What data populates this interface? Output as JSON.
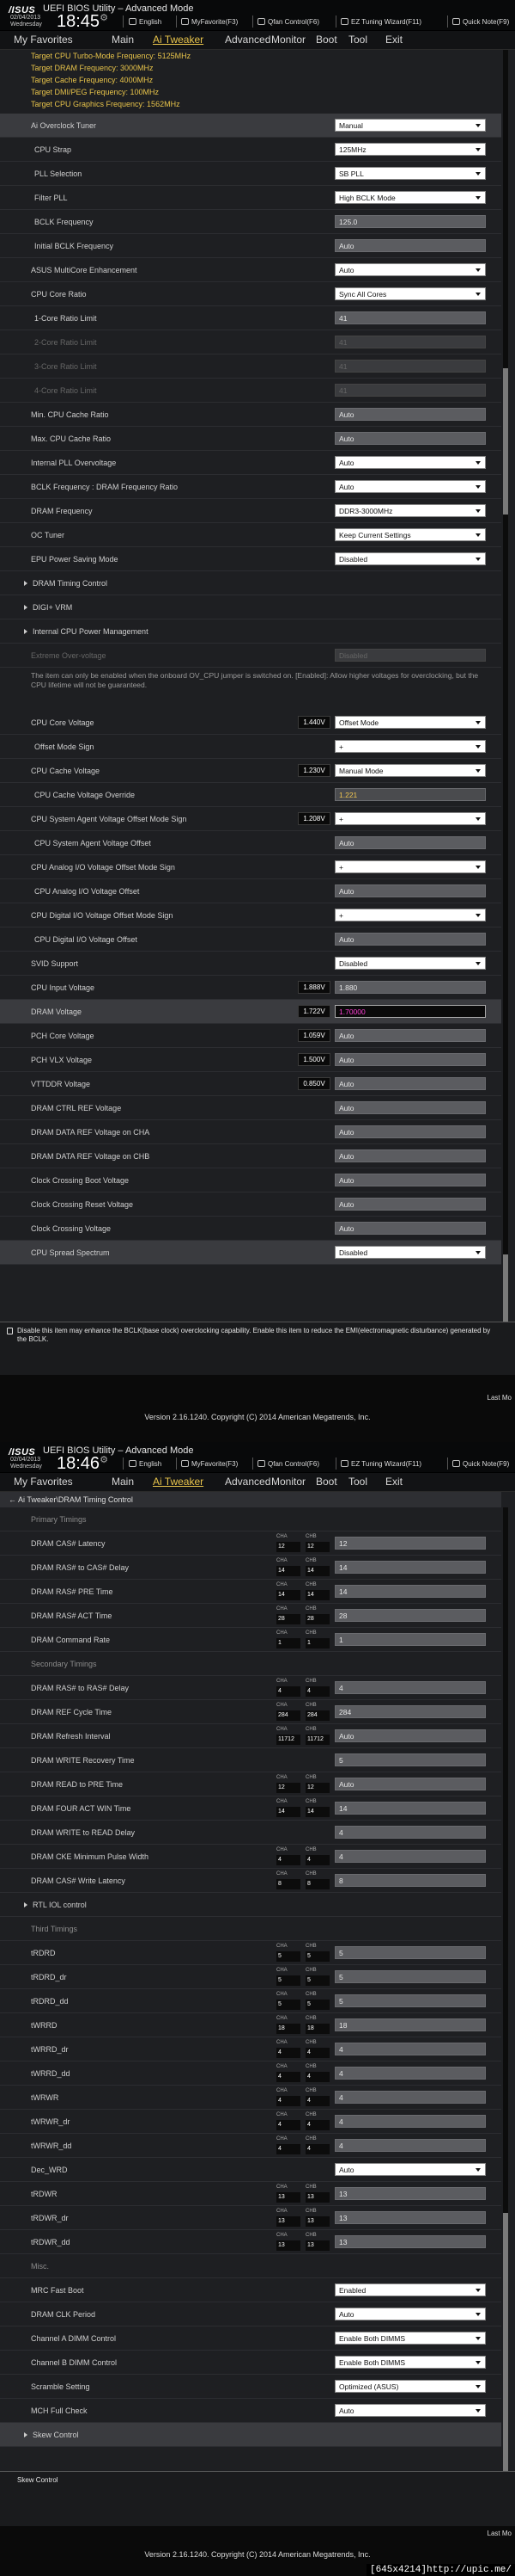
{
  "header": {
    "brand": "/ISUS",
    "title": "UEFI BIOS Utility – Advanced Mode",
    "date": "02/04/2013",
    "day": "Wednesday",
    "sep_glyph": "⚙",
    "items": [
      {
        "icon": "globe-icon",
        "label": "English"
      },
      {
        "icon": "star-icon",
        "label": "MyFavorite(F3)"
      },
      {
        "icon": "fan-icon",
        "label": "Qfan Control(F6)"
      },
      {
        "icon": "wand-icon",
        "label": "EZ Tuning Wizard(F11)"
      },
      {
        "icon": "note-icon",
        "label": "Quick Note(F9)"
      }
    ]
  },
  "nav": {
    "tabs": [
      "My Favorites",
      "Main",
      "Ai Tweaker",
      "Advanced",
      "Monitor",
      "Boot",
      "Tool",
      "Exit"
    ],
    "active": "Ai Tweaker"
  },
  "screen1": {
    "time": "18:45",
    "rows": [
      {
        "t": "yellow",
        "label": "Target CPU Turbo-Mode Frequency: 5125MHz"
      },
      {
        "t": "yellow",
        "label": "Target DRAM Frequency: 3000MHz"
      },
      {
        "t": "yellow",
        "label": "Target Cache Frequency: 4000MHz"
      },
      {
        "t": "yellow",
        "label": "Target DMI/PEG Frequency: 100MHz"
      },
      {
        "t": "yellow",
        "label": "Target CPU Graphics Frequency: 1562MHz"
      },
      {
        "t": "row",
        "label": "Ai Overclock Tuner",
        "sel": "Manual",
        "hl": true
      },
      {
        "t": "row",
        "label": "CPU Strap",
        "sel": "125MHz",
        "indent": 2
      },
      {
        "t": "row",
        "label": "PLL Selection",
        "sel": "SB PLL",
        "indent": 2
      },
      {
        "t": "row",
        "label": "Filter PLL",
        "sel": "High BCLK Mode",
        "indent": 2
      },
      {
        "t": "row",
        "label": "BCLK Frequency",
        "box": "125.0",
        "indent": 2
      },
      {
        "t": "row",
        "label": "Initial BCLK Frequency",
        "box": "Auto",
        "indent": 2
      },
      {
        "t": "row",
        "label": "ASUS MultiCore Enhancement",
        "sel": "Auto"
      },
      {
        "t": "row",
        "label": "CPU Core Ratio",
        "sel": "Sync All Cores"
      },
      {
        "t": "row",
        "label": "1-Core Ratio Limit",
        "box": "41",
        "indent": 2
      },
      {
        "t": "row",
        "label": "2-Core Ratio Limit",
        "box": "41",
        "indent": 2,
        "dim": true
      },
      {
        "t": "row",
        "label": "3-Core Ratio Limit",
        "box": "41",
        "indent": 2,
        "dim": true
      },
      {
        "t": "row",
        "label": "4-Core Ratio Limit",
        "box": "41",
        "indent": 2,
        "dim": true
      },
      {
        "t": "row",
        "label": "Min. CPU Cache Ratio",
        "box": "Auto"
      },
      {
        "t": "row",
        "label": "Max. CPU Cache Ratio",
        "box": "Auto"
      },
      {
        "t": "row",
        "label": "Internal PLL Overvoltage",
        "sel": "Auto"
      },
      {
        "t": "row",
        "label": "BCLK Frequency : DRAM Frequency Ratio",
        "sel": "Auto"
      },
      {
        "t": "row",
        "label": "DRAM Frequency",
        "sel": "DDR3-3000MHz"
      },
      {
        "t": "row",
        "label": "OC Tuner",
        "sel": "Keep Current Settings"
      },
      {
        "t": "row",
        "label": "EPU Power Saving Mode",
        "sel": "Disabled"
      },
      {
        "t": "sub",
        "label": "DRAM Timing Control"
      },
      {
        "t": "sub",
        "label": "DIGI+ VRM"
      },
      {
        "t": "sub",
        "label": "Internal CPU Power Management"
      },
      {
        "t": "row",
        "label": "Extreme Over-voltage",
        "box": "Disabled",
        "dim": true
      },
      {
        "t": "warn",
        "label": "The item can only be enabled when the onboard OV_CPU jumper is switched on. [Enabled]: Allow higher voltages for overclocking, but the CPU lifetime will not be guaranteed."
      },
      {
        "t": "row",
        "label": "CPU Core Voltage",
        "v": "1.440V",
        "sel": "Offset Mode"
      },
      {
        "t": "row",
        "label": "Offset Mode Sign",
        "sel": "+",
        "indent": 2
      },
      {
        "t": "row",
        "label": "CPU Cache Voltage",
        "v": "1.230V",
        "sel": "Manual Mode"
      },
      {
        "t": "row",
        "label": "CPU Cache Voltage Override",
        "box": "1.221",
        "gold": true,
        "indent": 2
      },
      {
        "t": "row",
        "label": "CPU System Agent Voltage Offset Mode Sign",
        "v": "1.208V",
        "sel": "+"
      },
      {
        "t": "row",
        "label": "CPU System Agent Voltage Offset",
        "box": "Auto",
        "indent": 2
      },
      {
        "t": "row",
        "label": "CPU Analog I/O Voltage Offset Mode Sign",
        "sel": "+"
      },
      {
        "t": "row",
        "label": "CPU Analog I/O Voltage Offset",
        "box": "Auto",
        "indent": 2
      },
      {
        "t": "row",
        "label": "CPU Digital I/O Voltage Offset Mode Sign",
        "sel": "+"
      },
      {
        "t": "row",
        "label": "CPU Digital I/O Voltage Offset",
        "box": "Auto",
        "indent": 2
      },
      {
        "t": "row",
        "label": "SVID Support",
        "sel": "Disabled"
      },
      {
        "t": "row",
        "label": "CPU Input Voltage",
        "v": "1.888V",
        "box": "1.880"
      },
      {
        "t": "row",
        "label": "DRAM Voltage",
        "v": "1.722V",
        "box": "1.70000",
        "mag": true,
        "hl": true
      },
      {
        "t": "row",
        "label": "PCH Core Voltage",
        "v": "1.059V",
        "box": "Auto"
      },
      {
        "t": "row",
        "label": "PCH VLX Voltage",
        "v": "1.500V",
        "box": "Auto"
      },
      {
        "t": "row",
        "label": "VTTDDR Voltage",
        "v": "0.850V",
        "box": "Auto"
      },
      {
        "t": "row",
        "label": "DRAM CTRL REF Voltage",
        "box": "Auto"
      },
      {
        "t": "row",
        "label": "DRAM DATA REF Voltage on CHA",
        "box": "Auto"
      },
      {
        "t": "row",
        "label": "DRAM DATA REF Voltage on CHB",
        "box": "Auto"
      },
      {
        "t": "row",
        "label": "Clock Crossing Boot Voltage",
        "box": "Auto"
      },
      {
        "t": "row",
        "label": "Clock Crossing Reset Voltage",
        "box": "Auto"
      },
      {
        "t": "row",
        "label": "Clock Crossing Voltage",
        "box": "Auto"
      },
      {
        "t": "row",
        "label": "CPU Spread Spectrum",
        "sel": "Disabled",
        "hl": true
      }
    ],
    "help": "Disable this item may enhance the BCLK(base clock) overclocking capability. Enable this item to reduce the EMI(electromagnetic disturbance) generated by the BCLK.",
    "last_modified": "Last Mo",
    "version": "Version 2.16.1240. Copyright (C) 2014 American Megatrends, Inc."
  },
  "screen2": {
    "time": "18:46",
    "breadcrumb": "←  Ai Tweaker\\DRAM Timing Control",
    "rows": [
      {
        "t": "sec",
        "label": "Primary Timings"
      },
      {
        "t": "row",
        "label": "DRAM CAS# Latency",
        "cha": "12",
        "chb": "12",
        "box": "12"
      },
      {
        "t": "row",
        "label": "DRAM RAS# to CAS# Delay",
        "cha": "14",
        "chb": "14",
        "box": "14"
      },
      {
        "t": "row",
        "label": "DRAM RAS# PRE Time",
        "cha": "14",
        "chb": "14",
        "box": "14"
      },
      {
        "t": "row",
        "label": "DRAM RAS# ACT Time",
        "cha": "28",
        "chb": "28",
        "box": "28"
      },
      {
        "t": "row",
        "label": "DRAM Command Rate",
        "cha": "1",
        "chb": "1",
        "box": "1"
      },
      {
        "t": "sec",
        "label": "Secondary Timings"
      },
      {
        "t": "row",
        "label": "DRAM RAS# to RAS# Delay",
        "cha": "4",
        "chb": "4",
        "box": "4"
      },
      {
        "t": "row",
        "label": "DRAM REF Cycle Time",
        "cha": "284",
        "chb": "284",
        "box": "284"
      },
      {
        "t": "row",
        "label": "DRAM Refresh Interval",
        "cha": "11712",
        "chb": "11712",
        "box": "Auto"
      },
      {
        "t": "row",
        "label": "DRAM WRITE Recovery Time",
        "box": "5"
      },
      {
        "t": "row",
        "label": "DRAM READ to PRE Time",
        "cha": "12",
        "chb": "12",
        "box": "Auto"
      },
      {
        "t": "row",
        "label": "DRAM FOUR ACT WIN Time",
        "cha": "14",
        "chb": "14",
        "box": "14"
      },
      {
        "t": "row",
        "label": "DRAM WRITE to READ Delay",
        "box": "4"
      },
      {
        "t": "row",
        "label": "DRAM CKE Minimum Pulse Width",
        "cha": "4",
        "chb": "4",
        "box": "4"
      },
      {
        "t": "row",
        "label": "DRAM CAS# Write Latency",
        "cha": "8",
        "chb": "8",
        "box": "8"
      },
      {
        "t": "sub",
        "label": "RTL IOL control"
      },
      {
        "t": "sec",
        "label": "Third Timings"
      },
      {
        "t": "row",
        "label": "tRDRD",
        "cha": "5",
        "chb": "5",
        "box": "5"
      },
      {
        "t": "row",
        "label": "tRDRD_dr",
        "cha": "5",
        "chb": "5",
        "box": "5"
      },
      {
        "t": "row",
        "label": "tRDRD_dd",
        "cha": "5",
        "chb": "5",
        "box": "5"
      },
      {
        "t": "row",
        "label": "tWRRD",
        "cha": "18",
        "chb": "18",
        "box": "18"
      },
      {
        "t": "row",
        "label": "tWRRD_dr",
        "cha": "4",
        "chb": "4",
        "box": "4"
      },
      {
        "t": "row",
        "label": "tWRRD_dd",
        "cha": "4",
        "chb": "4",
        "box": "4"
      },
      {
        "t": "row",
        "label": "tWRWR",
        "cha": "4",
        "chb": "4",
        "box": "4"
      },
      {
        "t": "row",
        "label": "tWRWR_dr",
        "cha": "4",
        "chb": "4",
        "box": "4"
      },
      {
        "t": "row",
        "label": "tWRWR_dd",
        "cha": "4",
        "chb": "4",
        "box": "4"
      },
      {
        "t": "row",
        "label": "Dec_WRD",
        "sel": "Auto"
      },
      {
        "t": "row",
        "label": "tRDWR",
        "cha": "13",
        "chb": "13",
        "box": "13"
      },
      {
        "t": "row",
        "label": "tRDWR_dr",
        "cha": "13",
        "chb": "13",
        "box": "13"
      },
      {
        "t": "row",
        "label": "tRDWR_dd",
        "cha": "13",
        "chb": "13",
        "box": "13"
      },
      {
        "t": "sec",
        "label": "Misc."
      },
      {
        "t": "row",
        "label": "MRC Fast Boot",
        "sel": "Enabled"
      },
      {
        "t": "row",
        "label": "DRAM CLK Period",
        "sel": "Auto"
      },
      {
        "t": "row",
        "label": "Channel A DIMM Control",
        "sel": "Enable Both DIMMS"
      },
      {
        "t": "row",
        "label": "Channel B DIMM Control",
        "sel": "Enable Both DIMMS"
      },
      {
        "t": "row",
        "label": "Scramble Setting",
        "sel": "Optimized (ASUS)"
      },
      {
        "t": "row",
        "label": "MCH Full Check",
        "sel": "Auto"
      },
      {
        "t": "sub",
        "label": "Skew Control",
        "hl": true
      }
    ],
    "ch_labels": [
      "CHA",
      "CHB"
    ],
    "help": "Skew Control",
    "last_modified": "Last Mo",
    "version": "Version 2.16.1240. Copyright (C) 2014 American Megatrends, Inc."
  },
  "watermark": "[645x4214]http://upic.me/"
}
